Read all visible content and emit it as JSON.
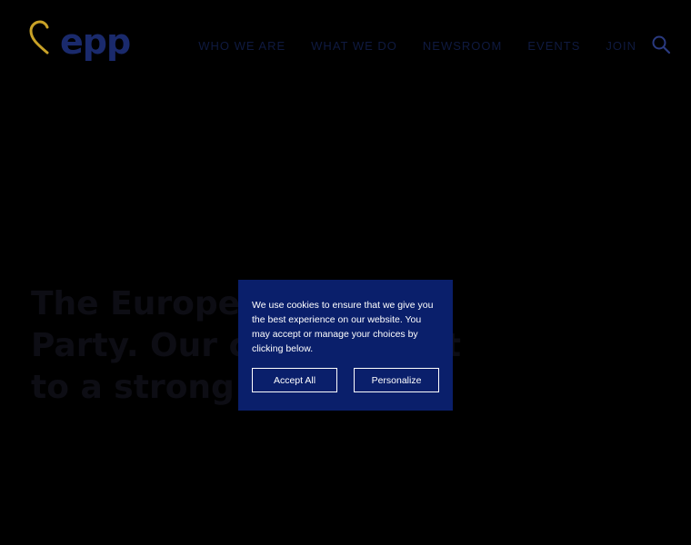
{
  "header": {
    "logo_text": "epp",
    "nav": [
      {
        "label": "Who we are"
      },
      {
        "label": "What we do"
      },
      {
        "label": "Newsroom"
      },
      {
        "label": "Events"
      },
      {
        "label": "Join"
      }
    ],
    "search_icon": "search-icon"
  },
  "hero": {
    "lines": [
      "The European People's",
      "Party. Our commitment",
      "to a strong Europe"
    ]
  },
  "cookie_banner": {
    "text": "We use cookies to ensure that we give you the best experience on our website. You may accept or manage your choices by clicking below.",
    "accept_label": "Accept All",
    "personalize_label": "Personalize"
  },
  "colors": {
    "background": "#000000",
    "cookie_bg": "#0a1f6b",
    "logo_blue": "#1a2a6c",
    "logo_heart": "#c9a227"
  }
}
